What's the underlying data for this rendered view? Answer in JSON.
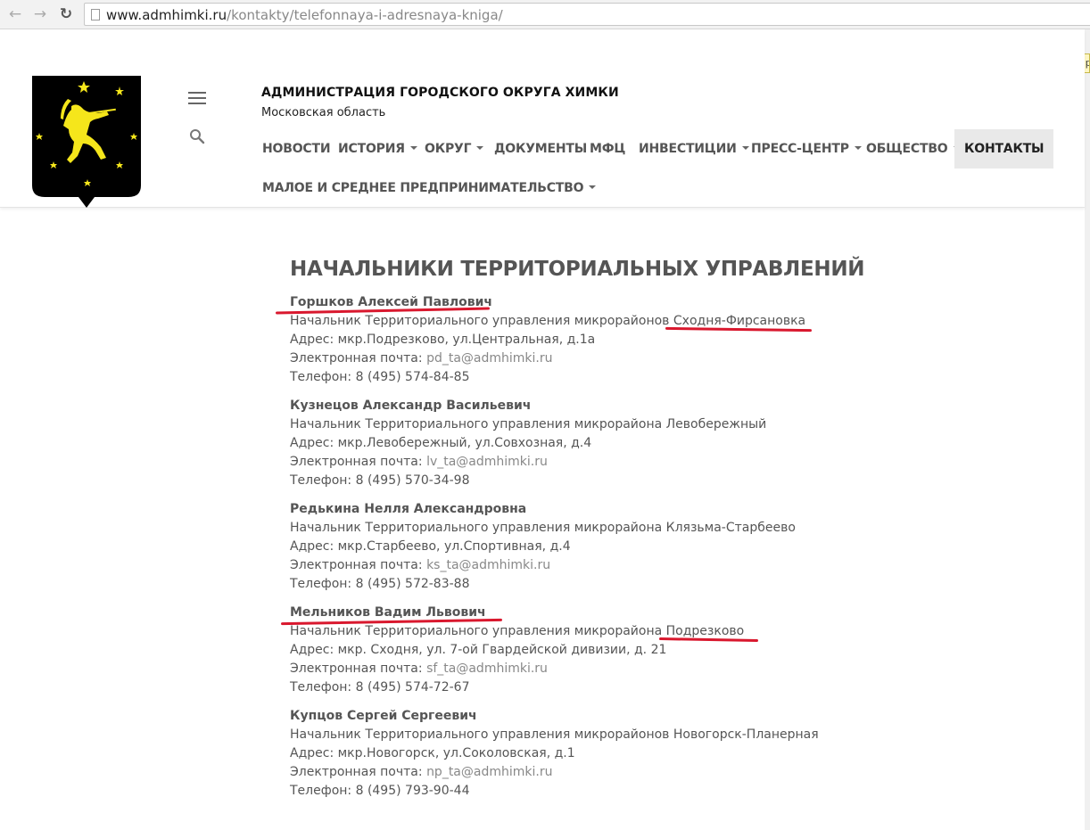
{
  "browser": {
    "url_host": "www.admhimki.ru",
    "url_path": "/kontakty/telefonnaya-i-adresnaya-kniga/",
    "back_icon": "arrow-left-icon",
    "forward_icon": "arrow-right-icon",
    "reload_icon": "reload-icon",
    "tooltip_text": "р"
  },
  "header": {
    "title": "АДМИНИСТРАЦИЯ ГОРОДСКОГО ОКРУГА ХИМКИ",
    "subtitle": "Московская область",
    "logo_icon": "coat-of-arms-icon",
    "colors": {
      "shield": "#000000",
      "figure": "#f5e61b"
    }
  },
  "nav": {
    "items": [
      {
        "label": "НОВОСТИ",
        "dropdown": false,
        "active": false
      },
      {
        "label": "ИСТОРИЯ",
        "dropdown": true,
        "active": false
      },
      {
        "label": "ОКРУГ",
        "dropdown": true,
        "active": false
      },
      {
        "label": "ДОКУМЕНТЫ",
        "dropdown": false,
        "active": false
      },
      {
        "label": "МФЦ",
        "dropdown": false,
        "active": false
      },
      {
        "label": "ИНВЕСТИЦИИ",
        "dropdown": true,
        "active": false
      },
      {
        "label": "ПРЕСС-ЦЕНТР",
        "dropdown": true,
        "active": false
      },
      {
        "label": "ОБЩЕСТВО",
        "dropdown": true,
        "active": false
      },
      {
        "label": "КОНТАКТЫ",
        "dropdown": false,
        "active": true
      },
      {
        "label": "МАЛОЕ И СРЕДНЕЕ ПРЕДПРИНИМАТЕЛЬСТВО",
        "dropdown": true,
        "active": false
      }
    ]
  },
  "content": {
    "title": "НАЧАЛЬНИКИ ТЕРРИТОРИАЛЬНЫХ УПРАВЛЕНИЙ",
    "email_label": "Электронная почта:",
    "people": [
      {
        "name": "Горшков Алексей Павлович",
        "position": "Начальник Территориального управления микрорайонов Сходня-Фирсановка",
        "address": "Адрес: мкр.Подрезково, ул.Центральная, д.1а",
        "email": "pd_ta@admhimki.ru",
        "phone": "Телефон: 8 (495) 574-84-85"
      },
      {
        "name": "Кузнецов Александр Васильевич",
        "position": "Начальник Территориального управления микрорайона Левобережный",
        "address": "Адрес: мкр.Левобережный, ул.Совхозная, д.4",
        "email": "lv_ta@admhimki.ru",
        "phone": "Телефон: 8 (495) 570-34-98"
      },
      {
        "name": "Редькина Нелля Александровна",
        "position": "Начальник Территориального управления микрорайона Клязьма-Старбеево",
        "address": "Адрес: мкр.Старбеево, ул.Спортивная, д.4",
        "email": "ks_ta@admhimki.ru",
        "phone": "Телефон: 8 (495) 572-83-88"
      },
      {
        "name": "Мельников Вадим Львович",
        "position": "Начальник Территориального управления микрорайона Подрезково",
        "address": "Адрес: мкр. Сходня, ул. 7-ой Гвардейской дивизии, д. 21",
        "email": "sf_ta@admhimki.ru",
        "phone": "Телефон: 8 (495) 574-72-67"
      },
      {
        "name": "Купцов Сергей Сергеевич",
        "position": "Начальник Территориального управления микрорайонов Новогорск-Планерная",
        "address": "Адрес: мкр.Новогорск, ул.Соколовская, д.1",
        "email": "np_ta@admhimki.ru",
        "phone": "Телефон: 8 (495) 793-90-44"
      }
    ],
    "annotation_color": "#d9182e"
  }
}
